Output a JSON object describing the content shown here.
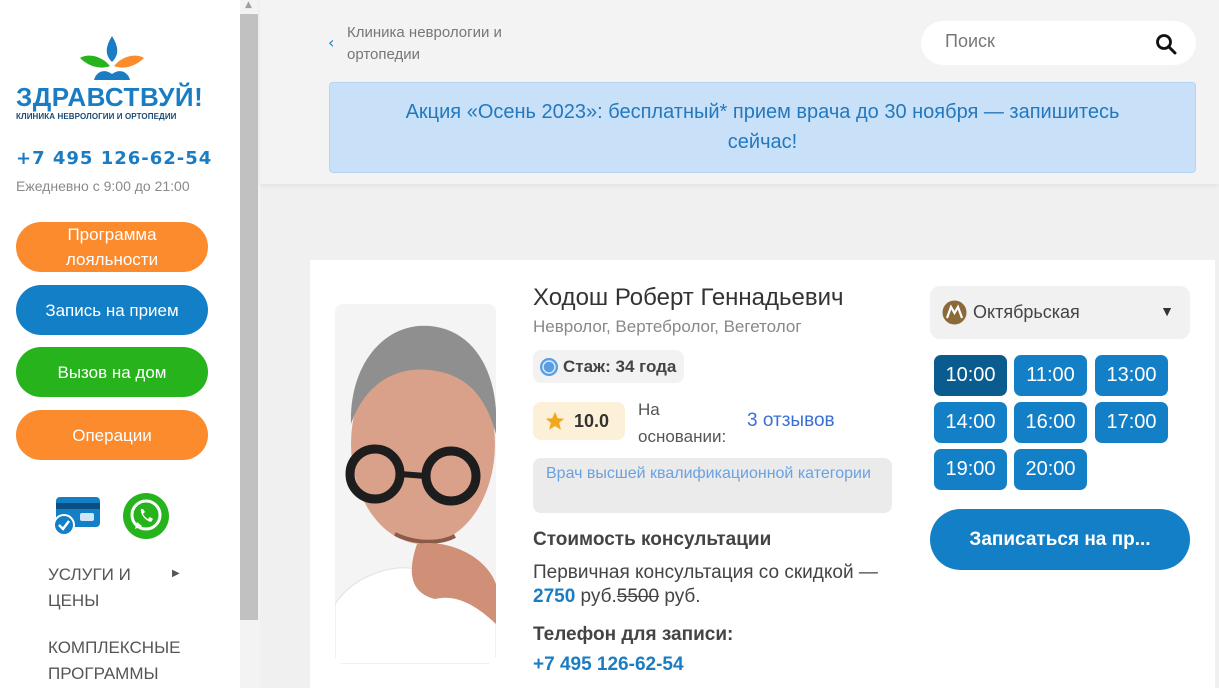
{
  "sidebar": {
    "logo_title": "ЗДРАВСТВУЙ!",
    "logo_subtitle": "КЛИНИКА НЕВРОЛОГИИ И ОРТОПЕДИИ",
    "phone": "+7 495 126-62-54",
    "hours": "Ежедневно с 9:00 до 21:00",
    "buttons": [
      {
        "label": "Программа лояльности"
      },
      {
        "label": "Запись на прием"
      },
      {
        "label": "Вызов на дом"
      },
      {
        "label": "Операции"
      }
    ],
    "menu": [
      {
        "label": "УСЛУГИ И ЦЕНЫ"
      },
      {
        "label": "КОМПЛЕКСНЫЕ ПРОГРАММЫ"
      }
    ]
  },
  "header": {
    "breadcrumb": "Клиника неврологии и ортопедии",
    "search_placeholder": "Поиск",
    "promo": "Акция «Осень 2023»: бесплатный* прием врача до 30 ноября — запишитесь сейчас!"
  },
  "doctor": {
    "name": "Ходош Роберт Геннадьевич",
    "specialty": "Невролог, Вертебролог, Вегетолог",
    "experience": "Стаж: 34 года",
    "rating": "10.0",
    "rating_basis": "На основании:",
    "reviews": "3 отзывов",
    "qualification": "Врач высшей квалификационной категории",
    "cost_title": "Стоимость консультации",
    "cost_prefix": "Первичная консультация со скидкой —",
    "cost_new": "2750",
    "cost_new_unit": " руб.",
    "cost_old": "5500",
    "cost_old_unit": " руб.",
    "phone_title": "Телефон для записи:",
    "phone": "+7 495 126-62-54"
  },
  "booking": {
    "metro": "Октябрьская",
    "slots": [
      "10:00",
      "11:00",
      "13:00",
      "14:00",
      "16:00",
      "17:00",
      "19:00",
      "20:00"
    ],
    "selected_slot": "10:00",
    "button": "Записаться на пр..."
  },
  "colors": {
    "brand_blue": "#137fc6",
    "orange": "#fb8b2d",
    "green": "#26b31c",
    "promo_bg": "#c8e1f8"
  }
}
